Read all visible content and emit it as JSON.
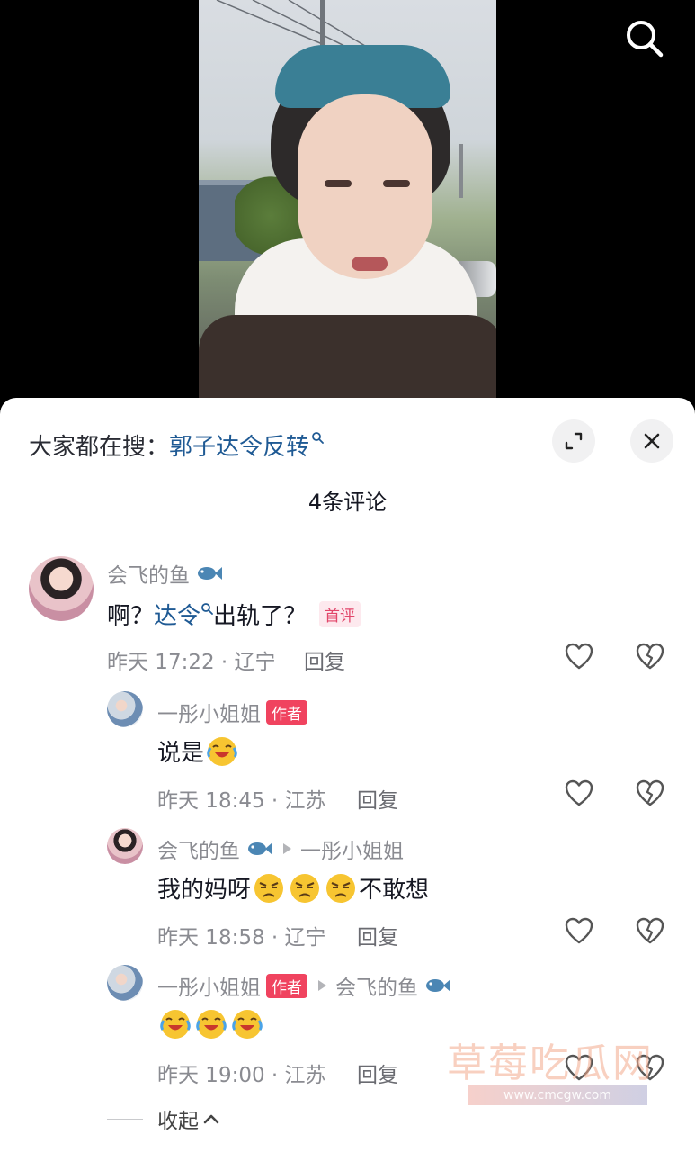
{
  "hot_search": {
    "prefix": "大家都在搜：",
    "keyword": "郭子达令反转"
  },
  "comment_count_label": "4条评论",
  "comments": [
    {
      "user": "会飞的鱼",
      "text_prefix": "啊？",
      "mention": "达令",
      "text_suffix": "出轨了？",
      "badge": "首评",
      "meta": "昨天 17:22 · 辽宁",
      "reply": "回复"
    },
    {
      "user": "一彤小姐姐",
      "badge": "作者",
      "text": "说是",
      "meta": "昨天 18:45 · 江苏",
      "reply": "回复"
    },
    {
      "user": "会飞的鱼",
      "reply_to": "一彤小姐姐",
      "text_prefix": "我的妈呀",
      "text_suffix": "不敢想",
      "meta": "昨天 18:58 · 辽宁",
      "reply": "回复"
    },
    {
      "user": "一彤小姐姐",
      "badge": "作者",
      "reply_to": "会飞的鱼",
      "meta": "昨天 19:00 · 江苏",
      "reply": "回复"
    }
  ],
  "collapse_label": "收起",
  "watermark": {
    "title": "草莓吃瓜网",
    "url": "www.cmcgw.com"
  },
  "colors": {
    "link": "#1f5a94",
    "author_badge": "#f0435f",
    "first_badge_text": "#e2466a"
  }
}
